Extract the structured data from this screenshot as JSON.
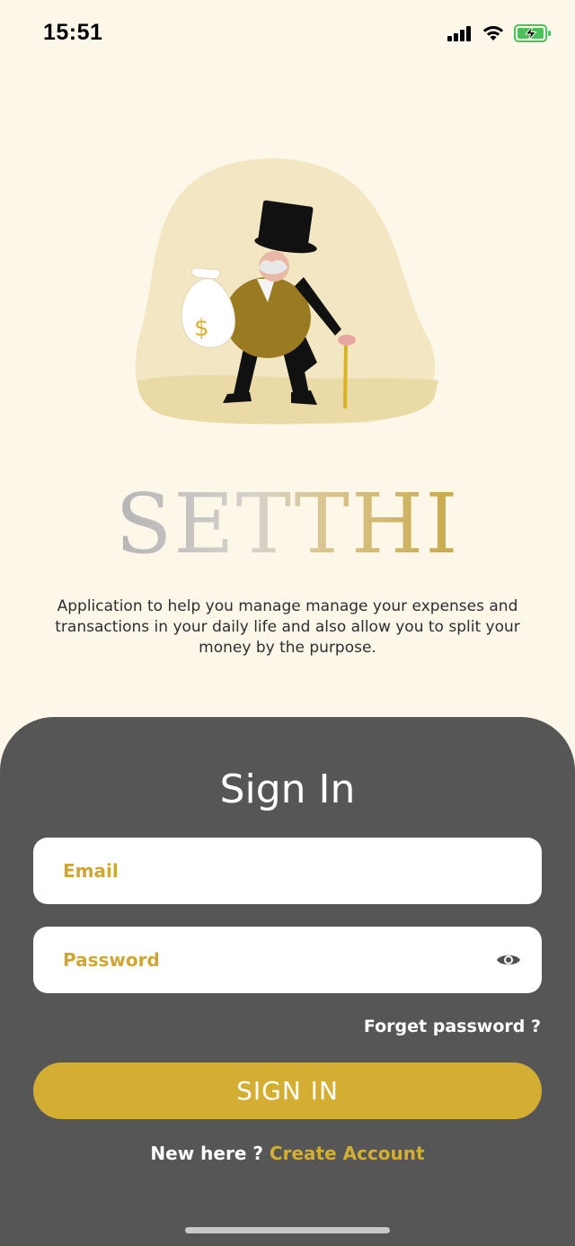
{
  "status_bar": {
    "time": "15:51",
    "icons": [
      "signal-icon",
      "wifi-icon",
      "battery-charging-icon"
    ]
  },
  "illustration": {
    "name": "rich-man-illustration",
    "bag_symbol": "$"
  },
  "brand": {
    "title": "SETTHI",
    "tagline": "Application to help you manage manage your expenses and transactions in your daily life and also allow you to split your money by the purpose."
  },
  "sign_in": {
    "title": "Sign In",
    "email_placeholder": "Email",
    "password_placeholder": "Password",
    "forgot_password": "Forget password ?",
    "submit_label": "SIGN IN",
    "new_here": "New here ?",
    "create_account": "Create Account"
  },
  "colors": {
    "background": "#fdf7ea",
    "sheet": "#565656",
    "accent": "#d3ae33",
    "blob": "#f3e7c3"
  }
}
